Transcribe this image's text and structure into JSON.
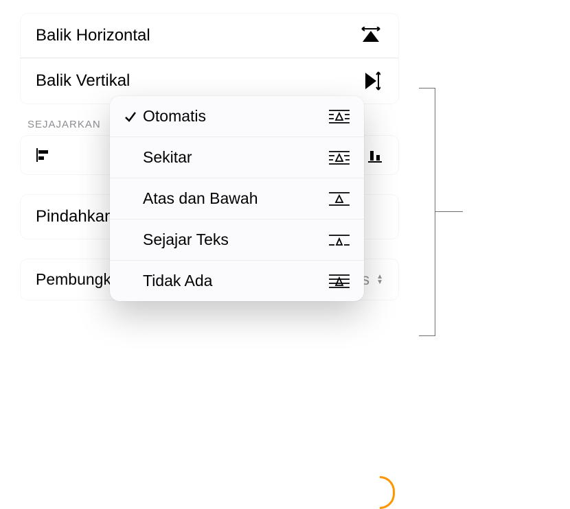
{
  "flip": {
    "horizontal": "Balik Horizontal",
    "vertical": "Balik Vertikal"
  },
  "align_header": "SEJAJARKAN",
  "move_label": "Pindahkan",
  "wrap": {
    "label": "Pembungkusan Teks",
    "value": "Otomatis"
  },
  "popup": {
    "items": [
      {
        "label": "Otomatis",
        "checked": true,
        "icon": "wrap-auto"
      },
      {
        "label": "Sekitar",
        "checked": false,
        "icon": "wrap-around"
      },
      {
        "label": "Atas dan Bawah",
        "checked": false,
        "icon": "wrap-top-bottom"
      },
      {
        "label": "Sejajar Teks",
        "checked": false,
        "icon": "wrap-inline"
      },
      {
        "label": "Tidak Ada",
        "checked": false,
        "icon": "wrap-none"
      }
    ]
  }
}
